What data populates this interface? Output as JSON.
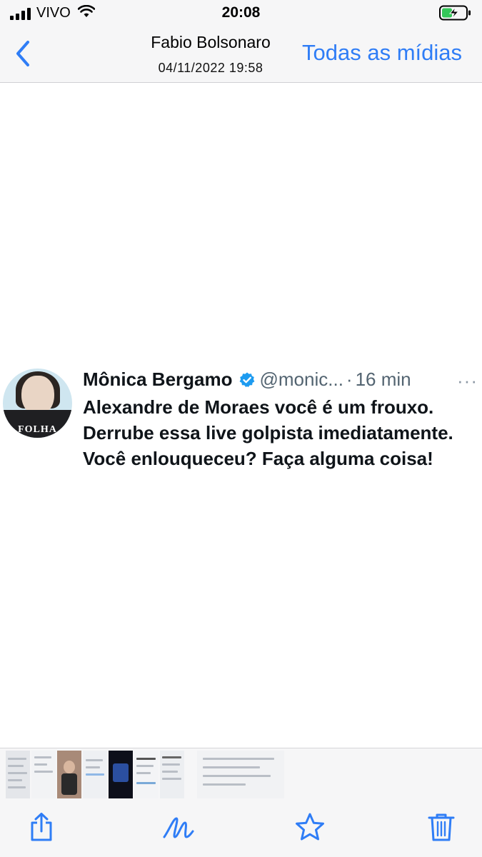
{
  "status_bar": {
    "carrier": "VIVO",
    "time": "20:08",
    "icons": [
      "signal-icon",
      "wifi-icon",
      "battery-charging-icon"
    ]
  },
  "nav": {
    "back_icon": "chevron-left-icon",
    "title": "Fabio Bolsonaro",
    "subtitle": "04/11/2022 19:58",
    "all_media_label": "Todas as mídias"
  },
  "tweet": {
    "author_name": "Mônica Bergamo",
    "verified_icon": "verified-badge-icon",
    "handle": "@monic...",
    "separator": "·",
    "time": "16 min",
    "avatar_logo": "FOLHA",
    "more_icon": "more-dots-icon",
    "text": "Alexandre de Moraes você é um frouxo. Derrube essa live golpista imediatamente. Você enlouqueceu? Faça alguma coisa!"
  },
  "toolbar": {
    "icons": [
      "share-icon",
      "markup-icon",
      "favorite-star-icon",
      "trash-icon"
    ]
  },
  "colors": {
    "accent": "#2f7df6",
    "bar_background": "#f6f6f7",
    "tweet_text": "#0f1419",
    "tweet_meta": "#536471",
    "verified": "#1d9bf0"
  }
}
